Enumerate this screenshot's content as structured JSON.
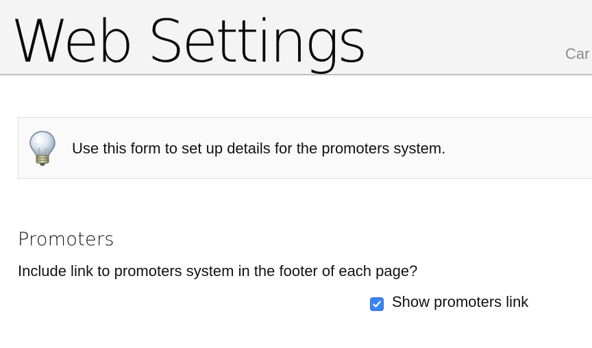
{
  "header": {
    "title": "Web Settings",
    "action_label": "Car"
  },
  "info": {
    "icon": "lightbulb-icon",
    "text": "Use this form to set up details for the promoters system."
  },
  "promoters": {
    "heading": "Promoters",
    "question": "Include link to promoters system in the footer of each page?",
    "checkbox_label": "Show promoters link",
    "checkbox_checked": true,
    "checkbox_color": "#3b82f6"
  }
}
